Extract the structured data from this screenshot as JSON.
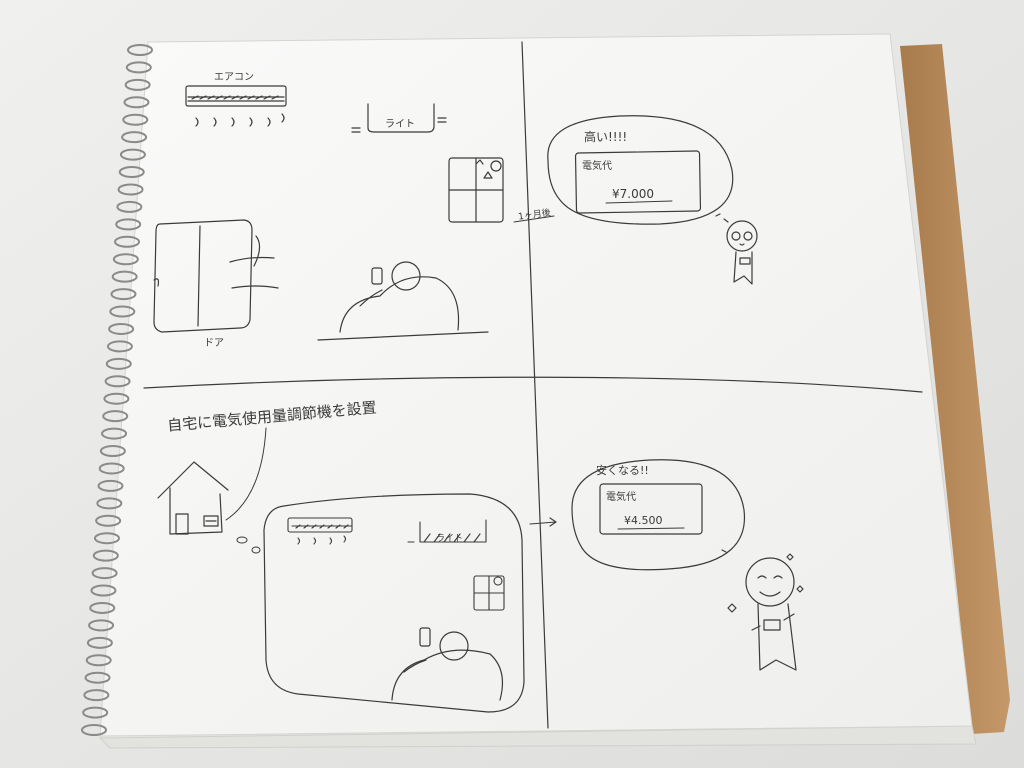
{
  "storyboard": {
    "panel1": {
      "aircon_label": "エアコン",
      "light_label": "ライト",
      "door_label": "ドア"
    },
    "panel2": {
      "time_label": "1ヶ月後",
      "exclaim": "高い!!!!",
      "bill_label": "電気代",
      "bill_amount": "¥7.000"
    },
    "panel3": {
      "caption": "自宅に電気使用量調節機を設置",
      "light_label": "ライト"
    },
    "panel4": {
      "exclaim": "安くなる!!",
      "bill_label": "電気代",
      "bill_amount": "¥4.500"
    }
  },
  "colors": {
    "background": "#e9e9e7",
    "paper": "#f7f7f5",
    "cardboard": "#b98e5e",
    "ink": "#3b3b3b"
  }
}
